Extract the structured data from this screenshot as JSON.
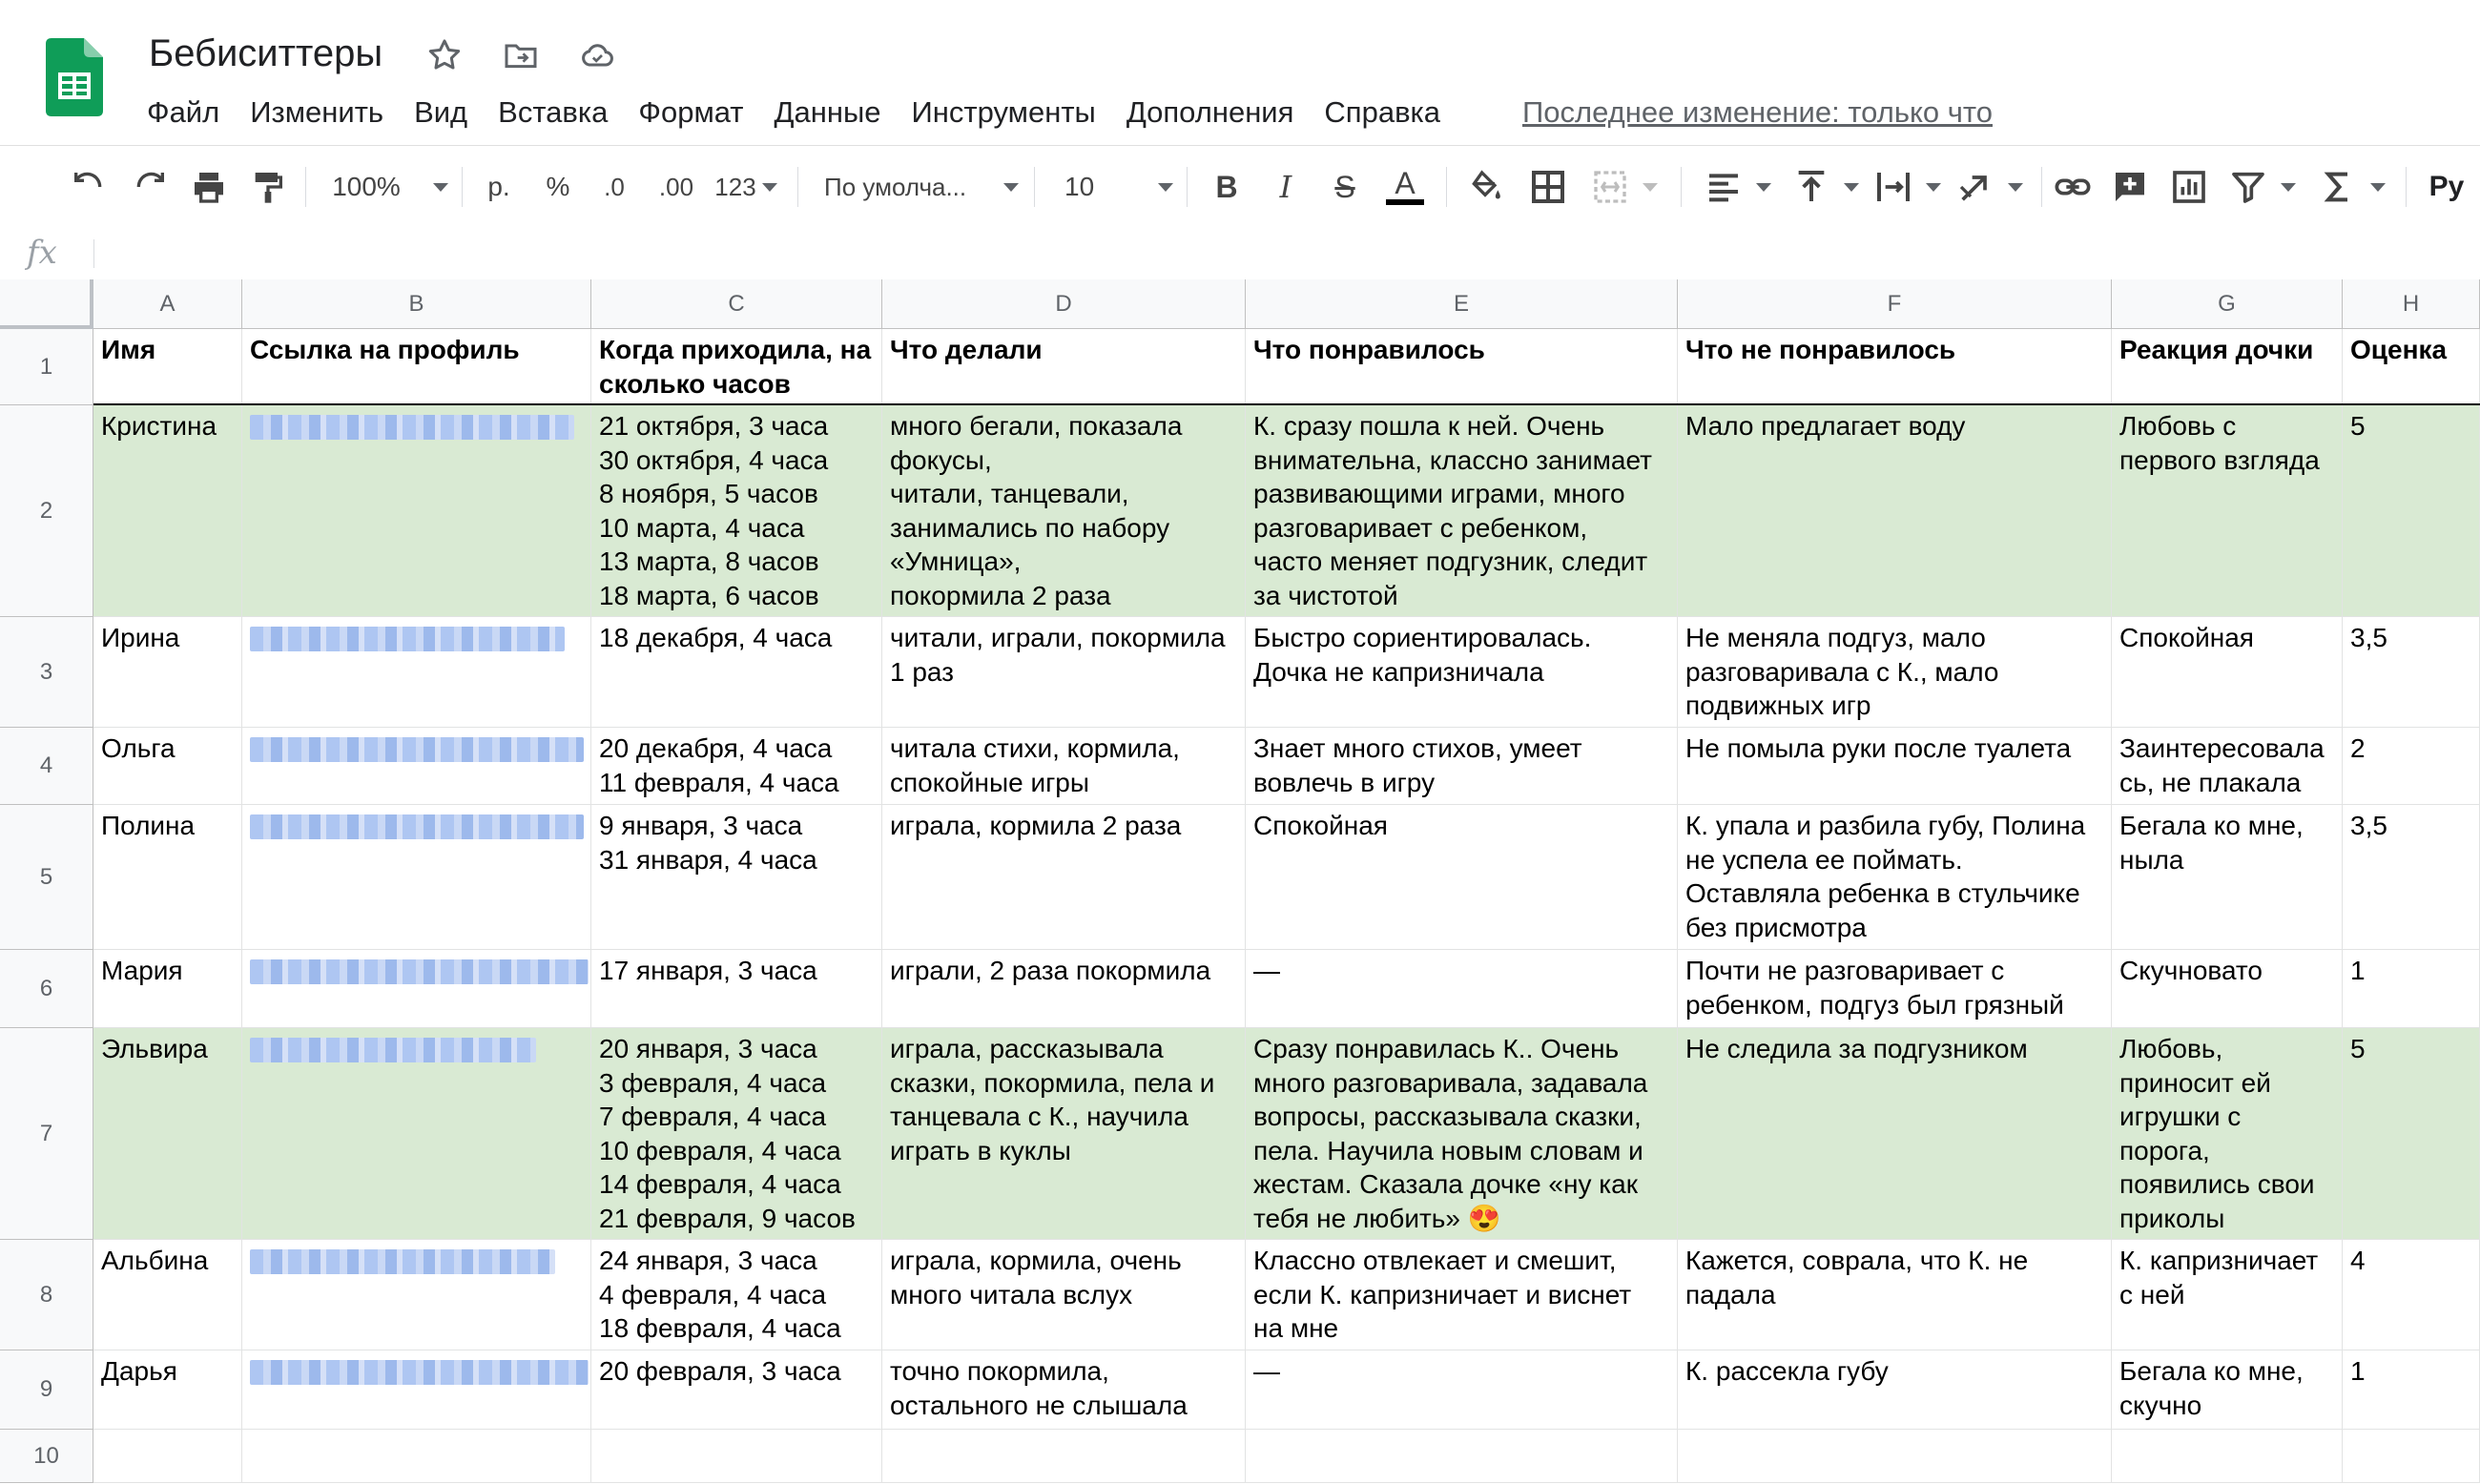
{
  "doc": {
    "title": "Бебиситтеры",
    "last_edit": "Последнее изменение: только что"
  },
  "menu": [
    "Файл",
    "Изменить",
    "Вид",
    "Вставка",
    "Формат",
    "Данные",
    "Инструменты",
    "Дополнения",
    "Справка"
  ],
  "toolbar": {
    "zoom": "100%",
    "currency": "р.",
    "percent": "%",
    "dec_less": ".0",
    "dec_more": ".00",
    "format_more": "123",
    "font": "По умолча...",
    "font_size": "10",
    "bold": "B",
    "italic": "I",
    "strike": "S",
    "text_color": "A",
    "more": "Рy"
  },
  "formula_bar": {
    "fx": "fx",
    "value": ""
  },
  "sheet": {
    "columns": [
      "A",
      "B",
      "C",
      "D",
      "E",
      "F",
      "G",
      "H"
    ],
    "row_numbers": [
      "1",
      "2",
      "3",
      "4",
      "5",
      "6",
      "7",
      "8",
      "9",
      "10"
    ],
    "header": [
      "Имя",
      "Ссылка на профиль",
      "Когда приходила, на сколько часов",
      "Что делали",
      "Что понравилось",
      "Что не понравилось",
      "Реакция дочки",
      "Оценка"
    ],
    "rows": [
      [
        "Кристина",
        "",
        "21 октября, 3 часа\n30 октября, 4 часа\n8 ноября, 5 часов\n10 марта, 4 часа\n13 марта, 8 часов\n18 марта, 6 часов",
        "много бегали, показала\nфокусы,\nчитали, танцевали,\nзанимались по набору\n«Умница»,\nпокормила 2 раза",
        "К. сразу пошла к ней. Очень\nвнимательна, классно занимает\nразвивающими играми, много\nразговаривает с ребенком,\nчасто меняет подгузник, следит\nза чистотой",
        "Мало предлагает воду",
        "Любовь с\nпервого взгляда",
        "5"
      ],
      [
        "Ирина",
        "",
        "18 декабря, 4 часа",
        "читали, играли, покормила\n1 раз",
        "Быстро сориентировалась.\nДочка не капризничала",
        "Не меняла подгуз, мало\nразговаривала с К., мало\nподвижных игр",
        "Спокойная",
        "3,5"
      ],
      [
        "Ольга",
        "",
        "20 декабря, 4 часа\n11 февраля, 4 часа",
        "читала стихи, кормила,\nспокойные игры",
        "Знает много стихов, умеет\nвовлечь в игру",
        "Не помыла руки после туалета",
        "Заинтересовала\nсь, не плакала",
        "2"
      ],
      [
        "Полина",
        "",
        "9 января, 3 часа\n31 января, 4 часа",
        "играла, кормила 2 раза",
        "Спокойная",
        "К. упала и разбила губу, Полина\nне успела ее поймать.\nОставляла ребенка в стульчике\nбез присмотра",
        "Бегала ко мне,\nныла",
        "3,5"
      ],
      [
        "Мария",
        "",
        "17 января, 3 часа",
        "играли, 2 раза покормила",
        "—",
        "Почти не разговаривает с\nребенком, подгуз был грязный",
        "Скучновато",
        "1"
      ],
      [
        "Эльвира",
        "",
        "20 января, 3 часа\n3 февраля, 4 часа\n7 февраля, 4 часа\n10 февраля, 4 часа\n14 февраля, 4 часа\n21 февраля, 9 часов",
        "играла, рассказывала\nсказки, покормила, пела и\nтанцевала с К., научила\nиграть в куклы",
        "Сразу понравилась К.. Очень\nмного разговаривала, задавала\nвопросы, рассказывала сказки,\nпела. Научила новым словам и\nжестам. Сказала дочке «ну как\nтебя не любить» 😍",
        "Не следила за подгузником",
        "Любовь,\nприносит ей\nигрушки с\nпорога,\nпоявились свои\nприколы",
        "5"
      ],
      [
        "Альбина",
        "",
        "24 января, 3 часа\n4 февраля, 4 часа\n18 февраля, 4 часа",
        "играла, кормила, очень\nмного читала вслух",
        "Классно отвлекает и смешит,\nесли К. капризничает и виснет\nна мне",
        "Кажется, соврала, что К. не\nпадала",
        "К. капризничает\nс ней",
        "4"
      ],
      [
        "Дарья",
        "",
        "20 февраля, 3 часа",
        "точно покормила,\nостального не слышала",
        "—",
        "К. рассекла губу",
        "Бегала ко мне,\nскучно",
        "1"
      ],
      [
        "",
        "",
        "",
        "",
        "",
        "",
        "",
        ""
      ]
    ],
    "highlighted_rows": [
      0,
      5
    ],
    "colors": {
      "highlight": "#d9ead3",
      "logo": "#0f9d58",
      "link_blur": "#aec6f2"
    }
  }
}
